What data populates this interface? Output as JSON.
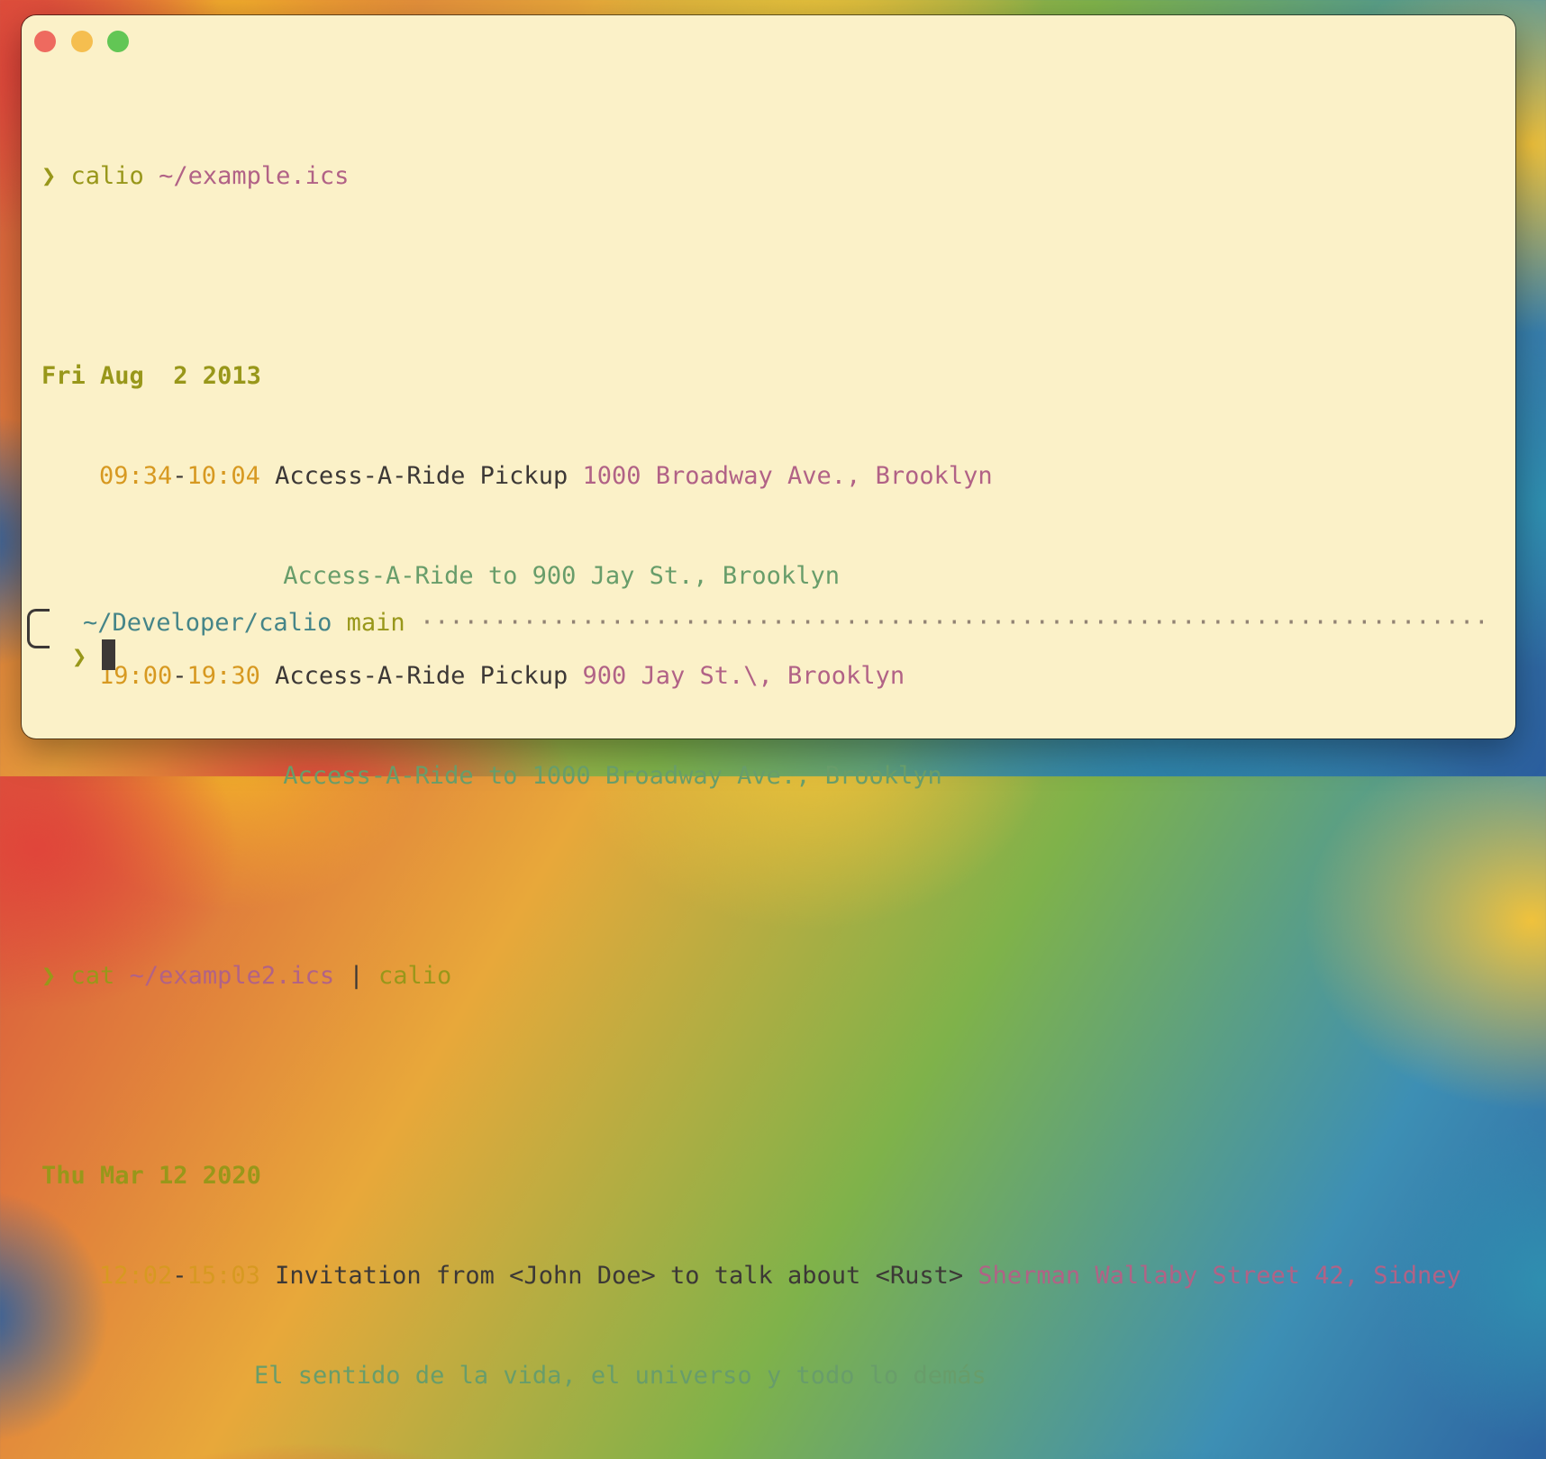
{
  "window": {
    "buttons": [
      "close",
      "minimize",
      "zoom"
    ]
  },
  "terminal": {
    "prompt_symbol": "❯",
    "session1": {
      "command": "calio",
      "argument": "~/example.ics",
      "date": "Fri Aug  2 2013",
      "events": [
        {
          "start": "09:34",
          "end": "10:04",
          "summary": "Access-A-Ride Pickup",
          "location": "1000 Broadway Ave., Brooklyn",
          "description": " Access-A-Ride to 900 Jay St., Brooklyn"
        },
        {
          "start": "19:00",
          "end": "19:30",
          "summary": "Access-A-Ride Pickup",
          "location": "900 Jay St.\\, Brooklyn",
          "description": " Access-A-Ride to 1000 Broadway Ave., Brooklyn"
        }
      ]
    },
    "session2": {
      "command": "cat",
      "argument": "~/example2.ics",
      "pipe": "|",
      "command2": "calio",
      "date": "Thu Mar 12 2020",
      "events": [
        {
          "start": "12:02",
          "end": "15:03",
          "summary": "Invitation from <John Doe> to talk about <Rust>",
          "location": "Sherman Wallaby Street 42, Sidney",
          "description": "El sentido de la vida, el universo y todo lo demás"
        }
      ]
    },
    "status": {
      "path": "~/Developer/calio",
      "branch": "main",
      "dots": "·········································································"
    }
  },
  "colors": {
    "background": "#fbf1c8",
    "green": "#98971a",
    "purple": "#b16286",
    "orange": "#d79921",
    "aqua": "#689d6a",
    "blue": "#458588",
    "fg": "#3c3836"
  }
}
